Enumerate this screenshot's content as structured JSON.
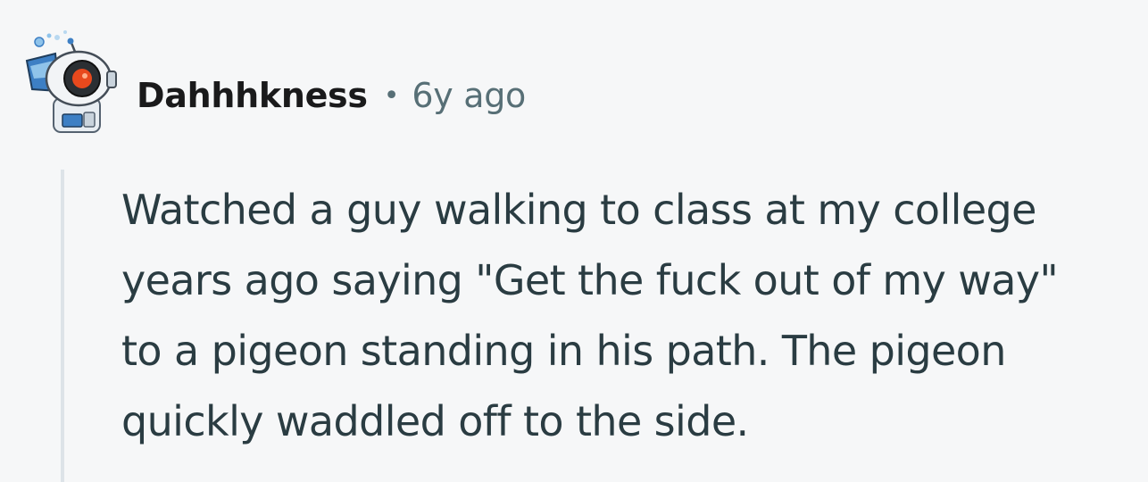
{
  "comment": {
    "author": "Dahhhkness",
    "separator": "•",
    "age": "6y ago",
    "avatar_icon": "snoo-robot-avatar-icon",
    "body_lines": [
      "Watched a guy walking to class at my college",
      "years ago saying \"Get the fuck out of my way\"",
      "to a pigeon standing in his path. The pigeon",
      "quickly waddled off to the side."
    ]
  },
  "colors": {
    "background": "#f6f7f8",
    "author": "#1a1a1b",
    "meta": "#576f76",
    "body": "#2a3c42",
    "thread_line": "#dde3e8",
    "avatar_accent": "#e8491d",
    "avatar_blue": "#3d7fc4"
  }
}
